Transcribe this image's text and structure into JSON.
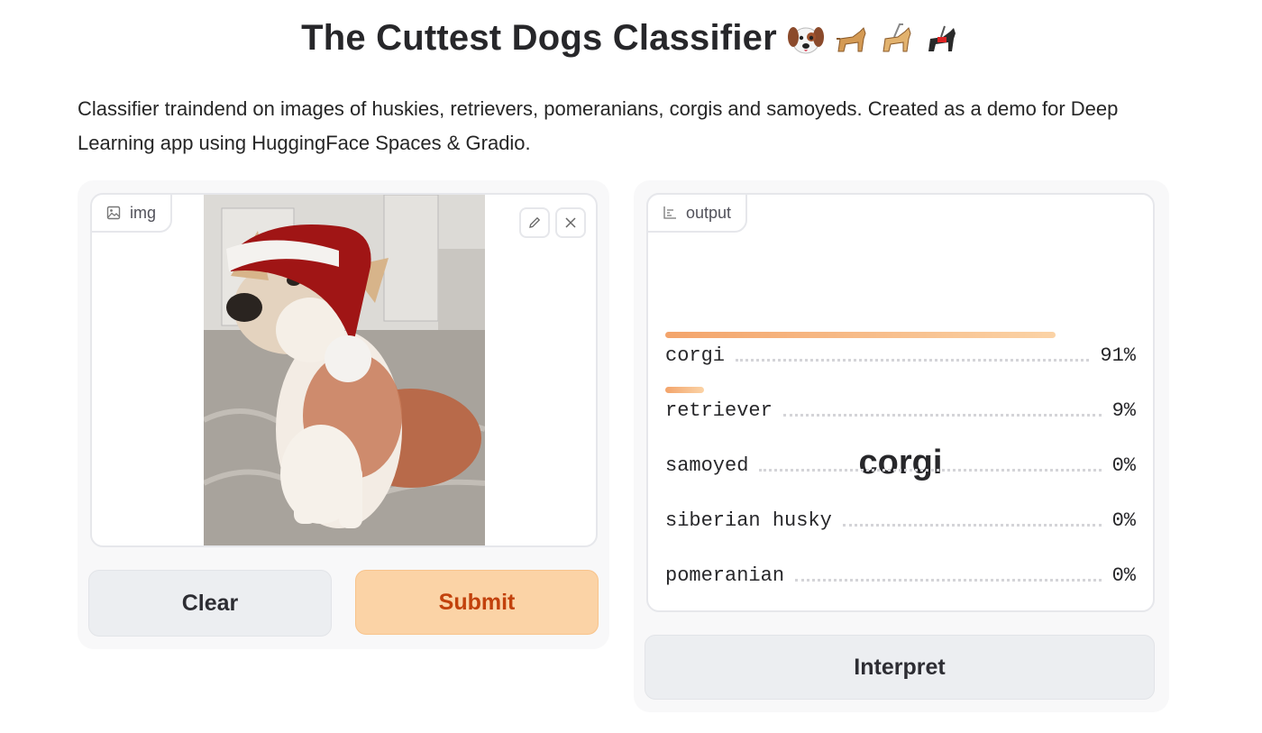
{
  "title": "The Cuttest Dogs Classifier",
  "description": "Classifier traindend on images of huskies, retrievers, pomeranians, corgis and samoyeds. Created as a demo for Deep Learning app using HuggingFace Spaces & Gradio.",
  "input": {
    "label": "img",
    "label_icon": "image-icon",
    "edit_icon": "pencil-icon",
    "close_icon": "close-icon"
  },
  "buttons": {
    "clear": "Clear",
    "submit": "Submit",
    "interpret": "Interpret"
  },
  "output": {
    "label": "output",
    "label_icon": "chart-icon",
    "predicted": "corgi",
    "confidences": [
      {
        "label": "corgi",
        "percent": "91%",
        "value": 0.91
      },
      {
        "label": "retriever",
        "percent": "9%",
        "value": 0.09
      },
      {
        "label": "samoyed",
        "percent": "0%",
        "value": 0.0
      },
      {
        "label": "siberian husky",
        "percent": "0%",
        "value": 0.0
      },
      {
        "label": "pomeranian",
        "percent": "0%",
        "value": 0.0
      }
    ]
  },
  "colors": {
    "accent": "#fbd3a6",
    "accent_text": "#c2410c",
    "bar": "#f3a46b"
  }
}
